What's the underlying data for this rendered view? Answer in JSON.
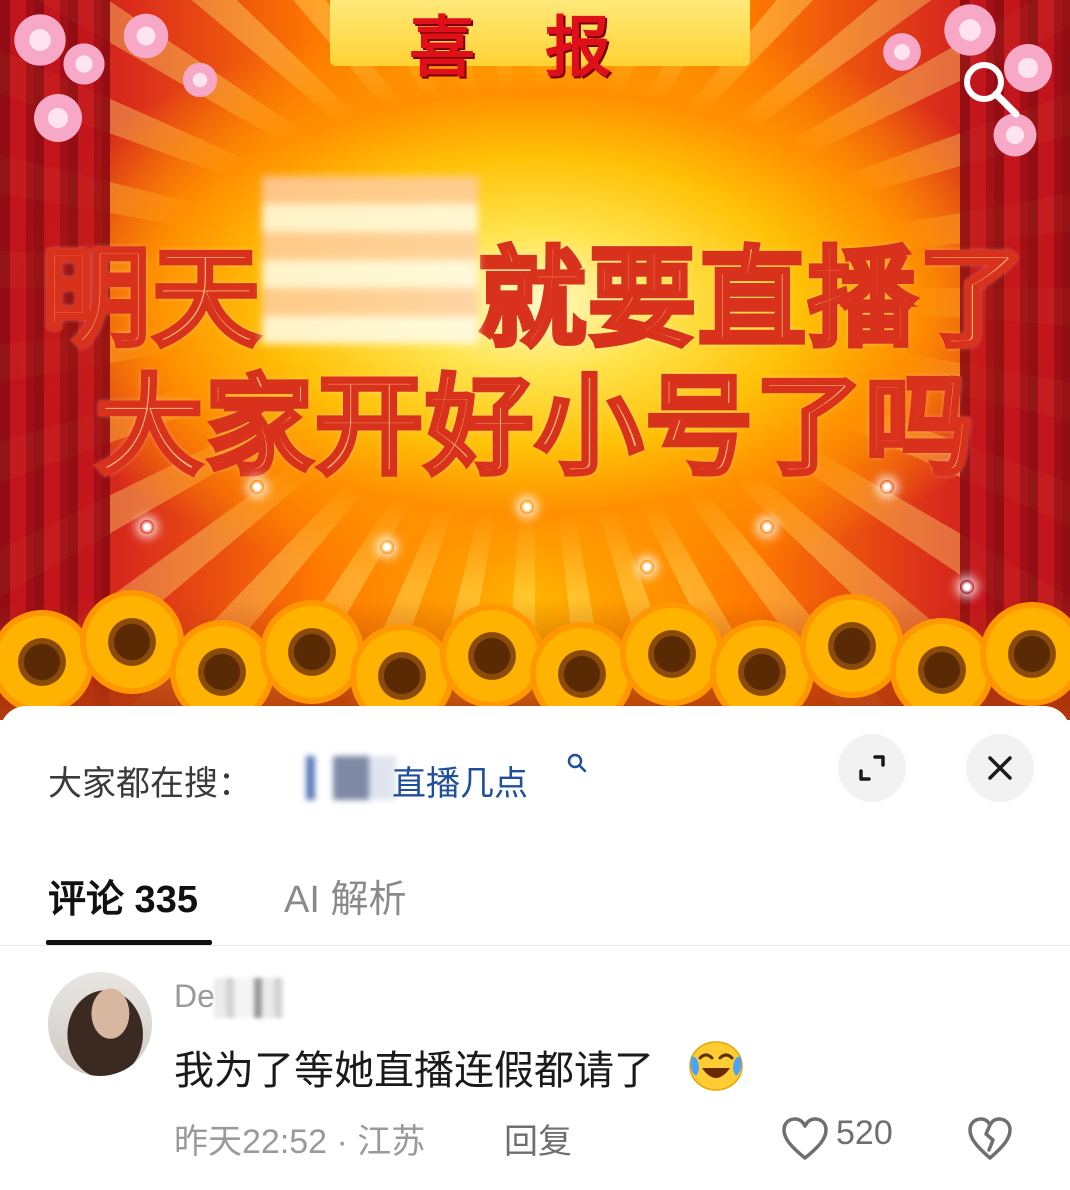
{
  "banner": {
    "header_title": "喜报",
    "headline_line1": "明天",
    "headline_line1_rest": "就要直播了",
    "headline_line2": "大家开好小号了吗",
    "search_icon": "search-icon"
  },
  "suggest": {
    "label": "大家都在搜：",
    "link_text": "直播几点",
    "icon": "search-small-icon"
  },
  "sheet_buttons": {
    "expand_icon": "expand-icon",
    "close_icon": "close-icon"
  },
  "tabs": {
    "comments_label": "评论 335",
    "ai_label": "AI 解析"
  },
  "comment": {
    "username": "De",
    "text": "我为了等她直播连假都请了",
    "emoji": "crying-laughing-emoji",
    "meta": "昨天22:52 · 江苏",
    "reply": "回复",
    "like_count": "520"
  },
  "colors": {
    "link": "#1f4f9b",
    "headline_fill": "#ffb37c",
    "headline_stroke": "#d8321c",
    "header_red": "#e0101b"
  }
}
